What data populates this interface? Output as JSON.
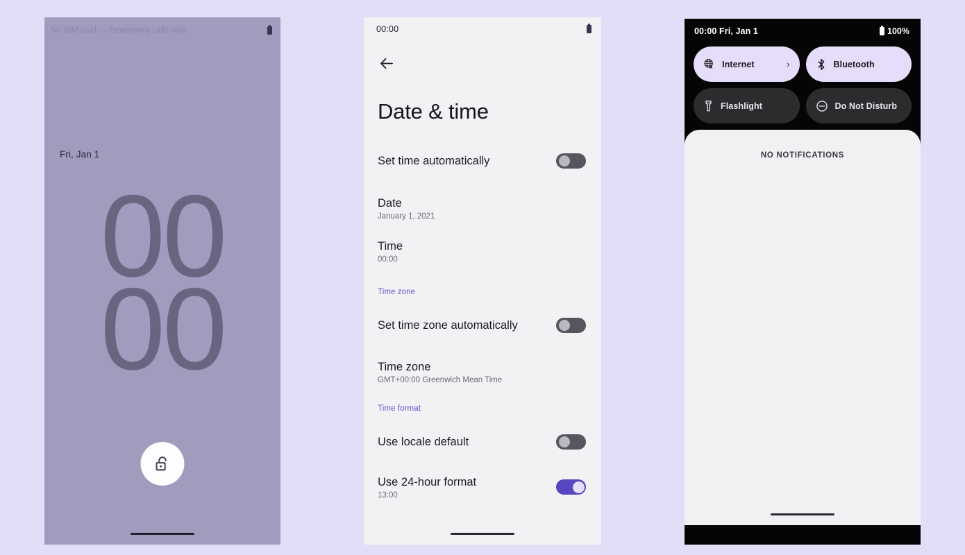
{
  "background_color": "#e4ddf8",
  "lock_screen": {
    "name": "android-lock-screen",
    "background_color": "#a29bbd",
    "status_bar": {
      "carrier_text": "No SIM card — Emergency calls only",
      "battery_icon": "battery-icon"
    },
    "date": "Fri, Jan 1",
    "clock": {
      "hours": "00",
      "minutes": "00"
    },
    "unlock_button": {
      "icon": "unlock-padlock-icon"
    },
    "home_indicator": "home-indicator"
  },
  "settings_screen": {
    "name": "date-and-time-settings",
    "background_color": "#f2f1f3",
    "status_bar": {
      "time": "00:00",
      "battery_icon": "battery-icon"
    },
    "back_button": {
      "icon": "back-arrow-icon"
    },
    "title": "Date & time",
    "items": [
      {
        "title": "Set time automatically",
        "subtitle": "",
        "control": "toggle",
        "state": "off"
      },
      {
        "title": "Date",
        "subtitle": "January 1, 2021",
        "control": "none",
        "state": ""
      },
      {
        "title": "Time",
        "subtitle": "00:00",
        "control": "none",
        "state": ""
      }
    ],
    "section_time_zone": {
      "header": "Time zone",
      "items": [
        {
          "title": "Set time zone automatically",
          "subtitle": "",
          "control": "toggle",
          "state": "off"
        },
        {
          "title": "Time zone",
          "subtitle": "GMT+00:00 Greenwich Mean Time",
          "control": "none",
          "state": ""
        }
      ]
    },
    "section_time_format": {
      "header": "Time format",
      "items": [
        {
          "title": "Use locale default",
          "subtitle": "",
          "control": "toggle",
          "state": "off"
        },
        {
          "title": "Use 24-hour format",
          "subtitle": "13:00",
          "control": "toggle",
          "state": "on"
        }
      ]
    },
    "toggle_colors": {
      "on_track": "#5646bf",
      "on_thumb": "#e5ddfb",
      "off_track": "#57555e",
      "off_thumb": "#b9b7bf"
    },
    "section_header_color": "#6750cf",
    "home_indicator": "home-indicator"
  },
  "quick_settings_screen": {
    "name": "quick-settings-shade",
    "background_color": "#050505",
    "status_bar": {
      "time_date": "00:00 Fri, Jan 1",
      "battery_percent": "100%",
      "battery_icon": "battery-icon"
    },
    "tiles": [
      {
        "label": "Internet",
        "icon": "globe-off-icon",
        "state": "active",
        "has_chevron": true,
        "chevron": "›"
      },
      {
        "label": "Bluetooth",
        "icon": "bluetooth-icon",
        "state": "active",
        "has_chevron": false,
        "chevron": ""
      },
      {
        "label": "Flashlight",
        "icon": "flashlight-icon",
        "state": "inactive",
        "has_chevron": false,
        "chevron": ""
      },
      {
        "label": "Do Not Disturb",
        "icon": "do-not-disturb-icon",
        "state": "inactive",
        "has_chevron": false,
        "chevron": ""
      }
    ],
    "tile_colors": {
      "active_bg": "#e6ddfa",
      "active_fg": "#1b1a1f",
      "inactive_bg": "#2c2b2e",
      "inactive_fg": "#e8e6ec"
    },
    "notifications": {
      "empty_text": "NO NOTIFICATIONS",
      "shade_bg": "#f1f0f2"
    },
    "home_indicator": "home-indicator"
  }
}
